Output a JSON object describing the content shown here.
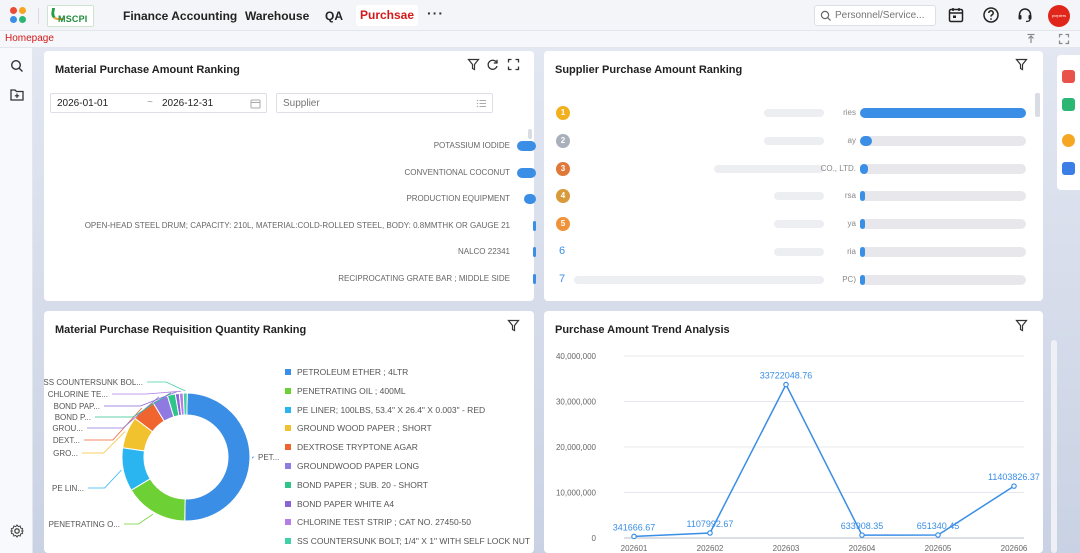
{
  "header": {
    "logo_text": "MSCPI",
    "nav": [
      "Finance Accounting",
      "Warehouse",
      "QA",
      "Purchsae"
    ],
    "active_nav": "Purchsae",
    "more": "···",
    "search_placeholder": "Personnel/Service...",
    "avatar_text": "pvrpiers"
  },
  "subbar": {
    "homepage": "Homepage"
  },
  "colors": {
    "accent": "#d4191a",
    "bar": "#3a8ee6",
    "brand_green": "#1f8a3d"
  },
  "material_purchase": {
    "title": "Material Purchase Amount Ranking",
    "date_start": "2026-01-01",
    "date_sep": "~",
    "date_end": "2026-12-31",
    "supplier_placeholder": "Supplier",
    "items": [
      {
        "label": "POTASSIUM IODIDE",
        "share": 0.95
      },
      {
        "label": "CONVENTIONAL COCONUT",
        "share": 0.95
      },
      {
        "label": "PRODUCTION EQUIPMENT",
        "share": 0.6
      },
      {
        "label": "OPEN-HEAD STEEL DRUM; CAPACITY: 210L, MATERIAL:COLD-ROLLED STEEL, BODY: 0.8MMTHK OR GAUGE 21",
        "share": 0.1
      },
      {
        "label": "NALCO 22341",
        "share": 0.1
      },
      {
        "label": "RECIPROCATING GRATE BAR ; MIDDLE SIDE",
        "share": 0.1
      }
    ]
  },
  "supplier_purchase": {
    "title": "Supplier Purchase Amount Ranking",
    "items": [
      {
        "rank": "1",
        "name": "ries",
        "share": 1.0
      },
      {
        "rank": "2",
        "name": "ay",
        "share": 0.07
      },
      {
        "rank": "3",
        "name": "CO., LTD.",
        "share": 0.05
      },
      {
        "rank": "4",
        "name": "rsa",
        "share": 0.02
      },
      {
        "rank": "5",
        "name": "ya",
        "share": 0.02
      },
      {
        "rank": "6",
        "name": "ria",
        "share": 0.01
      },
      {
        "rank": "7",
        "name": "PC)",
        "share": 0.01
      }
    ]
  },
  "requisition": {
    "title": "Material Purchase Requisition Quantity Ranking",
    "slice_labels": [
      "PET...",
      "PENETRATING O...",
      "PE LIN...",
      "GRO...",
      "DEXT...",
      "GROU...",
      "BOND P...",
      "BOND PAP...",
      "CHLORINE TE...",
      "SS COUNTERSUNK BOL..."
    ],
    "legend": [
      {
        "label": "PETROLEUM ETHER ; 4LTR",
        "color": "#3a8ee6",
        "value": 50
      },
      {
        "label": "PENETRATING OIL ; 400ML",
        "color": "#6dd135",
        "value": 16
      },
      {
        "label": "PE LINER; 100LBS, 53.4\" X 26.4\" X 0.003\" - RED",
        "color": "#2bb5f0",
        "value": 11
      },
      {
        "label": "GROUND WOOD PAPER ; SHORT",
        "color": "#f2c12e",
        "value": 8
      },
      {
        "label": "DEXTROSE TRYPTONE AGAR",
        "color": "#f0642f",
        "value": 6
      },
      {
        "label": "GROUNDWOOD PAPER LONG",
        "color": "#8e7ae0",
        "value": 4
      },
      {
        "label": "BOND PAPER ; SUB. 20 - SHORT",
        "color": "#2ec48a",
        "value": 2
      },
      {
        "label": "BOND PAPER WHITE A4",
        "color": "#8765d8",
        "value": 1
      },
      {
        "label": "CHLORINE TEST STRIP ; CAT NO. 27450-50",
        "color": "#b57de6",
        "value": 1
      },
      {
        "label": "SS COUNTERSUNK BOLT; 1/4\" X 1\" WITH SELF LOCK NUT",
        "color": "#41d1a8",
        "value": 1
      }
    ]
  },
  "trend": {
    "title": "Purchase Amount Trend Analysis"
  },
  "chart_data": [
    {
      "type": "line",
      "title": "Purchase Amount Trend Analysis",
      "x": [
        "202601",
        "202602",
        "202603",
        "202604",
        "202605",
        "202606"
      ],
      "y": [
        341666.67,
        1107992.67,
        33722048.76,
        633908.35,
        651340.45,
        11403826.37
      ],
      "point_labels": [
        "341666.67",
        "1107992.67",
        "33722048.76",
        "633908.35",
        "651340.45",
        "11403826.37"
      ],
      "yticks": [
        "0",
        "10,000,000",
        "20,000,000",
        "30,000,000",
        "40,000,000"
      ],
      "ylim": [
        0,
        40000000
      ],
      "grid": true
    },
    {
      "type": "pie",
      "title": "Material Purchase Requisition Quantity Ranking",
      "categories": [
        "PETROLEUM ETHER ; 4LTR",
        "PENETRATING OIL ; 400ML",
        "PE LINER; 100LBS, 53.4\" X 26.4\" X 0.003\" - RED",
        "GROUND WOOD PAPER ; SHORT",
        "DEXTROSE TRYPTONE AGAR",
        "GROUNDWOOD PAPER LONG",
        "BOND PAPER ; SUB. 20 - SHORT",
        "BOND PAPER WHITE A4",
        "CHLORINE TEST STRIP ; CAT NO. 27450-50",
        "SS COUNTERSUNK BOLT; 1/4\" X 1\" WITH SELF LOCK NUT"
      ],
      "values": [
        50,
        16,
        11,
        8,
        6,
        4,
        2,
        1,
        1,
        1
      ]
    }
  ]
}
